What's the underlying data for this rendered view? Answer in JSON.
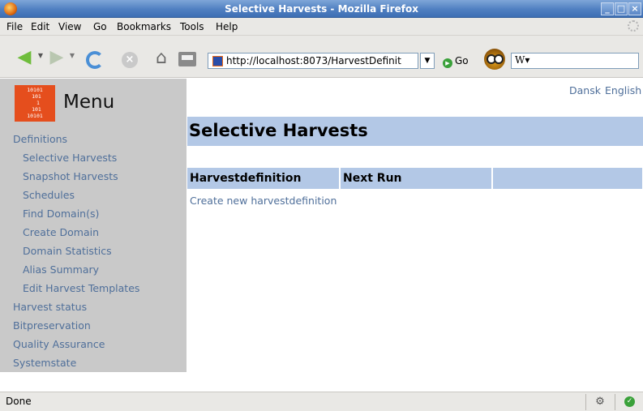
{
  "window": {
    "title": "Selective Harvests - Mozilla Firefox"
  },
  "menubar": {
    "items": [
      "File",
      "Edit",
      "View",
      "Go",
      "Bookmarks",
      "Tools",
      "Help"
    ]
  },
  "toolbar": {
    "url": "http://localhost:8073/HarvestDefinit",
    "go_label": "Go",
    "search_engine": "W",
    "search_value": ""
  },
  "sidebar": {
    "title": "Menu",
    "logo_text": "10101\n 101\n  1\n 101\n10101",
    "items": [
      {
        "label": "Definitions",
        "level": "top"
      },
      {
        "label": "Selective Harvests",
        "level": "sub"
      },
      {
        "label": "Snapshot Harvests",
        "level": "sub"
      },
      {
        "label": "Schedules",
        "level": "sub"
      },
      {
        "label": "Find Domain(s)",
        "level": "sub"
      },
      {
        "label": "Create Domain",
        "level": "sub"
      },
      {
        "label": "Domain Statistics",
        "level": "sub"
      },
      {
        "label": "Alias Summary",
        "level": "sub"
      },
      {
        "label": "Edit Harvest Templates",
        "level": "sub"
      },
      {
        "label": "Harvest status",
        "level": "top"
      },
      {
        "label": "Bitpreservation",
        "level": "top"
      },
      {
        "label": "Quality Assurance",
        "level": "top"
      },
      {
        "label": "Systemstate",
        "level": "top"
      }
    ]
  },
  "languages": [
    "Dansk",
    "English"
  ],
  "main": {
    "page_title": "Selective Harvests",
    "table_headers": [
      "Harvestdefinition",
      "Next Run",
      ""
    ],
    "create_link": "Create new harvestdefinition"
  },
  "statusbar": {
    "text": "Done"
  },
  "colors": {
    "sidebar_bg": "#c9c9c9",
    "header_band": "#b3c8e6",
    "link": "#4f6f9a",
    "logo": "#e54e1d"
  },
  "icons": [
    "firefox-icon",
    "back-arrow-icon",
    "forward-arrow-icon",
    "reload-icon",
    "stop-icon",
    "home-icon",
    "print-icon",
    "go-icon",
    "owl-icon",
    "wikipedia-icon",
    "security-icon",
    "check-icon"
  ]
}
